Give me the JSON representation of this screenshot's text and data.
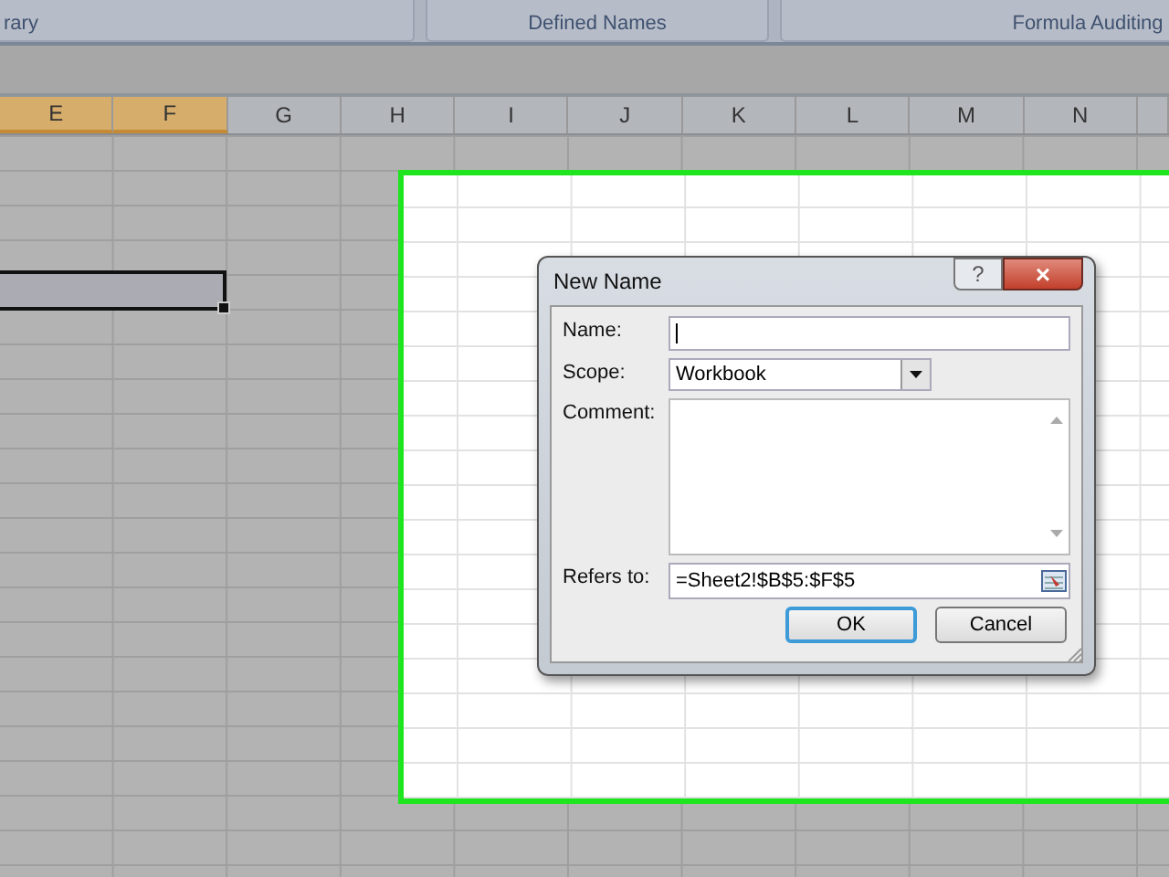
{
  "ribbon": {
    "groups": [
      {
        "label": "rary"
      },
      {
        "label": "Defined Names"
      },
      {
        "label": "Formula Auditing"
      }
    ]
  },
  "columns": [
    {
      "label": "E",
      "selected": true
    },
    {
      "label": "F",
      "selected": true
    },
    {
      "label": "G",
      "selected": false
    },
    {
      "label": "H",
      "selected": false
    },
    {
      "label": "I",
      "selected": false
    },
    {
      "label": "J",
      "selected": false
    },
    {
      "label": "K",
      "selected": false
    },
    {
      "label": "L",
      "selected": false
    },
    {
      "label": "M",
      "selected": false
    },
    {
      "label": "N",
      "selected": false
    }
  ],
  "dialog": {
    "title": "New Name",
    "help_button": "?",
    "close_button": "×",
    "fields": [
      {
        "kind": "text",
        "label": "Name:",
        "focused": true
      },
      {
        "kind": "dropdown",
        "label": "Scope:",
        "value": "Workbook"
      },
      {
        "kind": "textarea",
        "label": "Comment:"
      },
      {
        "kind": "reference",
        "label": "Refers to:",
        "value": "=Sheet2!$B$5:$F$5"
      }
    ],
    "buttons": [
      {
        "label": "OK",
        "default": true
      },
      {
        "label": "Cancel",
        "default": false
      }
    ]
  }
}
